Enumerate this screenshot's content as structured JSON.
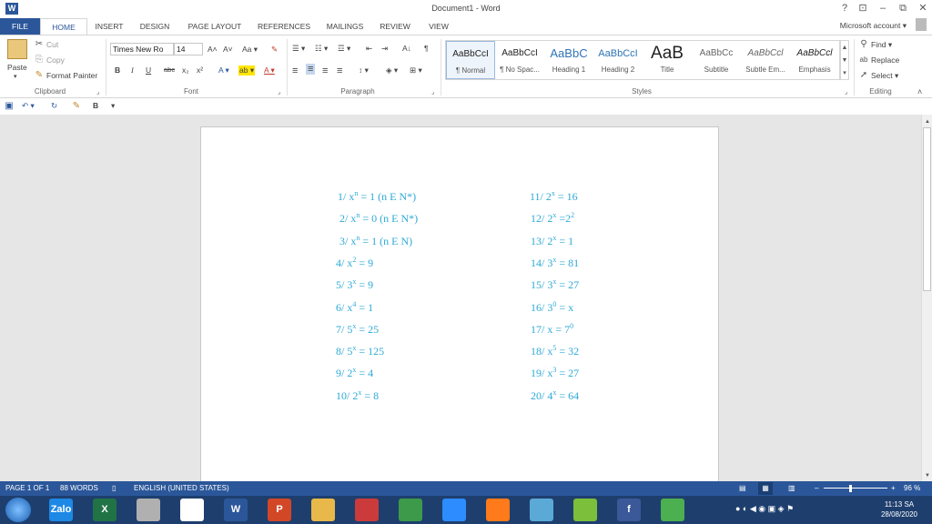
{
  "window": {
    "title": "Document1 - Word",
    "logo": "W",
    "help": "?",
    "ribbon_display": "⊡",
    "minimize": "–",
    "restore": "⧉",
    "close": "✕",
    "account": "Microsoft account ▾"
  },
  "tabs": [
    "FILE",
    "HOME",
    "INSERT",
    "DESIGN",
    "PAGE LAYOUT",
    "REFERENCES",
    "MAILINGS",
    "REVIEW",
    "VIEW"
  ],
  "ribbon": {
    "clipboard": {
      "paste": "Paste",
      "paste_caret": "▾",
      "cut": "Cut",
      "copy": "Copy",
      "format_painter": "Format Painter",
      "label": "Clipboard"
    },
    "font": {
      "name": "Times New Ro",
      "size": "14",
      "grow": "A˄",
      "shrink": "A˅",
      "case": "Aa ▾",
      "clear": "✎",
      "bold": "B",
      "italic": "I",
      "underline": "U",
      "strike": "abc",
      "subscript": "x₂",
      "superscript": "x²",
      "effects": "A ▾",
      "highlight": "ab ▾",
      "color": "A ▾",
      "label": "Font"
    },
    "paragraph": {
      "bullets": "☰ ▾",
      "numbering": "☷ ▾",
      "multilevel": "☲ ▾",
      "decrease": "⇤",
      "increase": "⇥",
      "sort": "A↓",
      "show": "¶",
      "align_left": "≡",
      "center": "≡",
      "align_right": "≡",
      "justify": "≡",
      "spacing": "↕ ▾",
      "shading": "◈ ▾",
      "borders": "⊞ ▾",
      "label": "Paragraph"
    },
    "styles": {
      "items": [
        {
          "preview": "AaBbCcI",
          "name": "¶ Normal"
        },
        {
          "preview": "AaBbCcI",
          "name": "¶ No Spac..."
        },
        {
          "preview": "AaBbC",
          "name": "Heading 1"
        },
        {
          "preview": "AaBbCcI",
          "name": "Heading 2"
        },
        {
          "preview": "AaB",
          "name": "Title"
        },
        {
          "preview": "AaBbCc",
          "name": "Subtitle"
        },
        {
          "preview": "AaBbCcl",
          "name": "Subtle Em..."
        },
        {
          "preview": "AaBbCcl",
          "name": "Emphasis"
        }
      ],
      "label": "Styles"
    },
    "editing": {
      "find": "Find ▾",
      "replace": "Replace",
      "select": "Select ▾",
      "label": "Editing"
    }
  },
  "qat": {
    "save": "💾",
    "undo": "↶ ▾",
    "redo": "↻",
    "painter": "🖌",
    "bold": "B",
    "more": "▾"
  },
  "equations_left": [
    {
      "pre": "1/ ",
      "base": "x",
      "sup": "n",
      "post": " = 1 (n E N*)"
    },
    {
      "pre": "2/ ",
      "base": "x",
      "sup": "n",
      "post": " = 0 (n E N*)"
    },
    {
      "pre": "3/ ",
      "base": "x",
      "sup": "n",
      "post": " = 1 (n E N)"
    },
    {
      "pre": "4/ ",
      "base": "x",
      "sup": "2",
      "post": " = 9"
    },
    {
      "pre": "5/ ",
      "base": "3",
      "sup": "x",
      "post": " = 9"
    },
    {
      "pre": "6/ ",
      "base": "x",
      "sup": "4",
      "post": " = 1"
    },
    {
      "pre": "7/ ",
      "base": "5",
      "sup": "x",
      "post": " = 25"
    },
    {
      "pre": "8/ ",
      "base": "5",
      "sup": "x",
      "post": " = 125"
    },
    {
      "pre": "9/ ",
      "base": "2",
      "sup": "x",
      "post": " = 4"
    },
    {
      "pre": "10/ ",
      "base": "2",
      "sup": "x",
      "post": " = 8"
    }
  ],
  "equations_right": [
    {
      "pre": "11/ ",
      "base": "2",
      "sup": "x",
      "post": " = 16"
    },
    {
      "pre": "12/ ",
      "base": "2",
      "sup": "x",
      "post": " =2",
      "sup2": "2"
    },
    {
      "pre": "13/ ",
      "base": "2",
      "sup": "x",
      "post": " = 1"
    },
    {
      "pre": "14/ ",
      "base": "3",
      "sup": "x",
      "post": " = 81"
    },
    {
      "pre": "15/ ",
      "base": "3",
      "sup": "x",
      "post": " = 27"
    },
    {
      "pre": "16/ ",
      "base": "3",
      "sup": "0",
      "post": " = x"
    },
    {
      "pre": "17/ ",
      "base": "x",
      "sup": "",
      "post": " = 7",
      "sup2": "0"
    },
    {
      "pre": "18/ ",
      "base": "x",
      "sup": "5",
      "post": " = 32"
    },
    {
      "pre": "19/ ",
      "base": "x",
      "sup": "3",
      "post": " = 27"
    },
    {
      "pre": "20/ ",
      "base": "4",
      "sup": "x",
      "post": " = 64"
    }
  ],
  "status": {
    "page": "PAGE 1 OF 1",
    "words": "88 WORDS",
    "language": "ENGLISH (UNITED STATES)",
    "zoom": "96 %",
    "zoom_minus": "–",
    "zoom_plus": "+"
  },
  "taskbar": {
    "apps": [
      {
        "label": "Zalo",
        "color": "#1e88e5"
      },
      {
        "label": "X",
        "color": "#217346"
      },
      {
        "label": "",
        "color": "#b0b0b0"
      },
      {
        "label": "",
        "color": "#ffffff"
      },
      {
        "label": "W",
        "color": "#2b579a"
      },
      {
        "label": "P",
        "color": "#d24726"
      },
      {
        "label": "",
        "color": "#e8b84a"
      },
      {
        "label": "",
        "color": "#cc3b3b"
      },
      {
        "label": "",
        "color": "#3d9a4a"
      },
      {
        "label": "",
        "color": "#2d8cff"
      },
      {
        "label": "",
        "color": "#ff7a1a"
      },
      {
        "label": "",
        "color": "#5aa9d6"
      },
      {
        "label": "",
        "color": "#7cbf3a"
      },
      {
        "label": "f",
        "color": "#3b5998"
      },
      {
        "label": "",
        "color": "#4caf50"
      }
    ],
    "time": "11:13 SA",
    "date": "28/08/2020"
  },
  "colors": {
    "accent": "#2b579a",
    "equation": "#2ea9d6"
  }
}
